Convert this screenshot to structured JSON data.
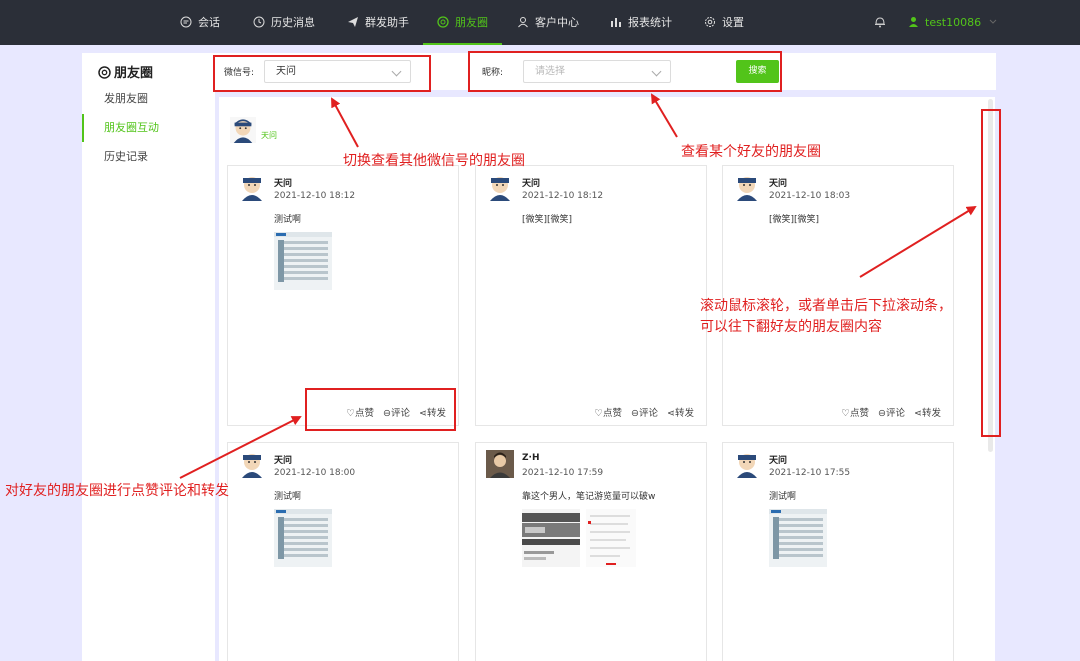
{
  "nav": {
    "items": [
      {
        "label": "会话",
        "icon": "chat-icon"
      },
      {
        "label": "历史消息",
        "icon": "clock-icon"
      },
      {
        "label": "群发助手",
        "icon": "send-icon"
      },
      {
        "label": "朋友圈",
        "icon": "moments-icon",
        "active": true
      },
      {
        "label": "客户中心",
        "icon": "user-icon"
      },
      {
        "label": "报表统计",
        "icon": "bar-chart-icon"
      },
      {
        "label": "设置",
        "icon": "gear-icon"
      }
    ],
    "username": "test10086"
  },
  "sidebar": {
    "title": "朋友圈",
    "items": [
      {
        "label": "发朋友圈"
      },
      {
        "label": "朋友圈互动",
        "active": true
      },
      {
        "label": "历史记录"
      }
    ]
  },
  "filters": {
    "wechat_label": "微信号:",
    "wechat_value": "天问",
    "nickname_label": "昵称:",
    "nickname_placeholder": "请选择",
    "search_label": "搜索"
  },
  "friend": {
    "name": "天问"
  },
  "posts": [
    {
      "name": "天问",
      "time": "2021-12-10 18:12",
      "text": "测试啊",
      "has_image": true
    },
    {
      "name": "天问",
      "time": "2021-12-10 18:12",
      "text": "[微笑][微笑]",
      "has_image": false
    },
    {
      "name": "天问",
      "time": "2021-12-10 18:03",
      "text": "[微笑][微笑]",
      "has_image": false
    },
    {
      "name": "天问",
      "time": "2021-12-10 18:00",
      "text": "测试啊",
      "has_image": true
    },
    {
      "name": "Z·H",
      "time": "2021-12-10 17:59",
      "text": "靠这个男人，笔记游览量可以破w",
      "has_image": true
    },
    {
      "name": "天问",
      "time": "2021-12-10 17:55",
      "text": "测试啊",
      "has_image": true
    }
  ],
  "actions": {
    "like": "点赞",
    "comment": "评论",
    "share": "转发"
  },
  "annotations": {
    "switch_account": "切换查看其他微信号的朋友圈",
    "view_friend": "查看某个好友的朋友圈",
    "scroll_line1": "滚动鼠标滚轮，或者单击后下拉滚动条，",
    "scroll_line2": "可以往下翻好友的朋友圈内容",
    "interact": "对好友的朋友圈进行点赞评论和转发"
  },
  "colors": {
    "accent": "#52c41a",
    "topbar": "#2b2f38",
    "annotation": "#e02020",
    "background": "#e8e8ff"
  }
}
